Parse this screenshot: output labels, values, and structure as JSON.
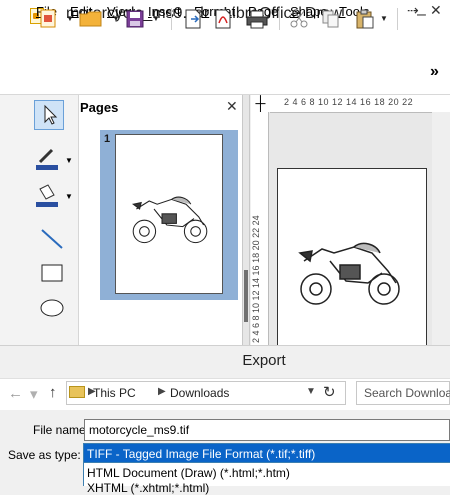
{
  "window": {
    "title": "motorcycle_ms9.cdr - LibreOffice Draw"
  },
  "menu": {
    "items": [
      {
        "pre": "",
        "key": "F",
        "post": "ile"
      },
      {
        "pre": "",
        "key": "E",
        "post": "dit"
      },
      {
        "pre": "",
        "key": "V",
        "post": "iew"
      },
      {
        "pre": "",
        "key": "I",
        "post": "nsert"
      },
      {
        "pre": "F",
        "key": "o",
        "post": "rmat"
      },
      {
        "pre": "",
        "key": "P",
        "post": "age"
      },
      {
        "pre": "",
        "key": "S",
        "post": "hape"
      },
      {
        "pre": "",
        "key": "T",
        "post": "ools"
      }
    ]
  },
  "pages_panel": {
    "title": "Pages",
    "page_number": "1"
  },
  "rulers": {
    "horizontal": "2 4 6 8 10 12 14 16 18 20 22",
    "vertical": "2 4 6 8 10 12 14 16 18 20 22 24"
  },
  "dialog": {
    "title": "Export",
    "breadcrumb": [
      "This PC",
      "Downloads"
    ],
    "search_placeholder": "Search Downloads",
    "file_name_label": "File name:",
    "file_name_value": "motorcycle_ms9.tif",
    "save_as_label": "Save as type:",
    "selected_type": "TIFF - Tagged Image File Format (*.tif;*.tiff)",
    "type_options": [
      "HTML Document (Draw) (*.html;*.htm)",
      "XHTML (*.xhtml;*.html)"
    ]
  },
  "colors": {
    "selection": "#0a64c8",
    "page_thumb_highlight": "#8fb0d6",
    "folder": "#e8c35a"
  }
}
